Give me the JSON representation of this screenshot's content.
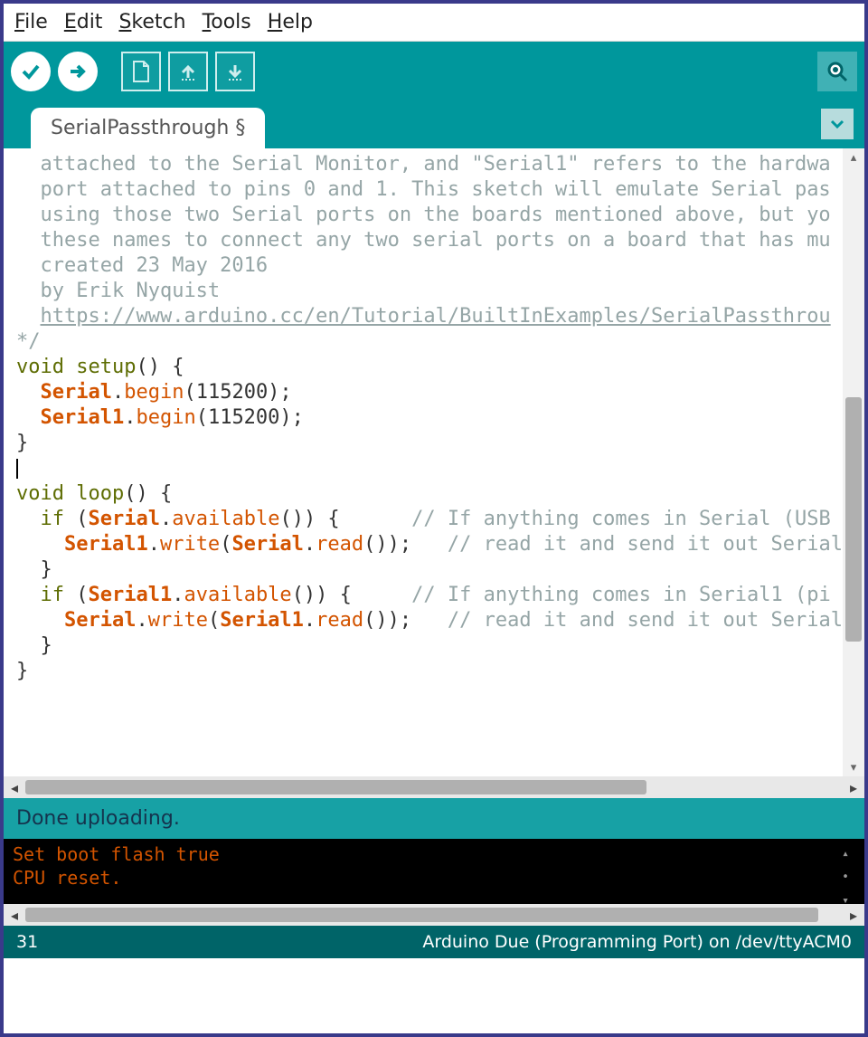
{
  "menu": {
    "file": "File",
    "edit": "Edit",
    "sketch": "Sketch",
    "tools": "Tools",
    "help": "Help"
  },
  "toolbar_icons": {
    "verify": "check-icon",
    "upload": "arrow-right-icon",
    "new": "file-icon",
    "open": "arrow-up-icon",
    "save": "arrow-down-icon",
    "serial_monitor": "magnifier-icon"
  },
  "tab": {
    "name": "SerialPassthrough",
    "modified": "§"
  },
  "code_lines": [
    {
      "indent": "  ",
      "spans": [
        [
          "c-comment",
          "attached to the Serial Monitor, and \"Serial1\" refers to the hardwa"
        ]
      ]
    },
    {
      "indent": "  ",
      "spans": [
        [
          "c-comment",
          "port attached to pins 0 and 1. This sketch will emulate Serial pas"
        ]
      ]
    },
    {
      "indent": "  ",
      "spans": [
        [
          "c-comment",
          "using those two Serial ports on the boards mentioned above, but yo"
        ]
      ]
    },
    {
      "indent": "  ",
      "spans": [
        [
          "c-comment",
          "these names to connect any two serial ports on a board that has mu"
        ]
      ]
    },
    {
      "indent": "",
      "spans": [
        [
          "c-comment",
          ""
        ]
      ]
    },
    {
      "indent": "  ",
      "spans": [
        [
          "c-comment",
          "created 23 May 2016"
        ]
      ]
    },
    {
      "indent": "  ",
      "spans": [
        [
          "c-comment",
          "by Erik Nyquist"
        ]
      ]
    },
    {
      "indent": "",
      "spans": [
        [
          "c-comment",
          ""
        ]
      ]
    },
    {
      "indent": "  ",
      "spans": [
        [
          "c-link",
          "https://www.arduino.cc/en/Tutorial/BuiltInExamples/SerialPassthrou"
        ]
      ]
    },
    {
      "indent": "",
      "spans": [
        [
          "c-comment",
          "*/"
        ]
      ]
    },
    {
      "indent": "",
      "spans": [
        [
          "",
          ""
        ]
      ]
    },
    {
      "indent": "",
      "spans": [
        [
          "c-kw",
          "void"
        ],
        [
          "",
          " "
        ],
        [
          "c-kw",
          "setup"
        ],
        [
          "c-struct",
          "() {"
        ]
      ]
    },
    {
      "indent": "  ",
      "spans": [
        [
          "c-class",
          "Serial"
        ],
        [
          "c-struct",
          "."
        ],
        [
          "c-method",
          "begin"
        ],
        [
          "c-struct",
          "(115200);"
        ]
      ]
    },
    {
      "indent": "  ",
      "spans": [
        [
          "c-class",
          "Serial1"
        ],
        [
          "c-struct",
          "."
        ],
        [
          "c-method",
          "begin"
        ],
        [
          "c-struct",
          "(115200);"
        ]
      ]
    },
    {
      "indent": "",
      "spans": [
        [
          "c-struct",
          "}"
        ]
      ]
    },
    {
      "indent": "",
      "spans": [
        [
          "cursor",
          ""
        ]
      ]
    },
    {
      "indent": "",
      "spans": [
        [
          "c-kw",
          "void"
        ],
        [
          "",
          " "
        ],
        [
          "c-kw",
          "loop"
        ],
        [
          "c-struct",
          "() {"
        ]
      ]
    },
    {
      "indent": "  ",
      "spans": [
        [
          "c-kw",
          "if"
        ],
        [
          "c-struct",
          " ("
        ],
        [
          "c-class",
          "Serial"
        ],
        [
          "c-struct",
          "."
        ],
        [
          "c-method",
          "available"
        ],
        [
          "c-struct",
          "()) {      "
        ],
        [
          "c-comment",
          "// If anything comes in Serial (USB"
        ]
      ]
    },
    {
      "indent": "    ",
      "spans": [
        [
          "c-class",
          "Serial1"
        ],
        [
          "c-struct",
          "."
        ],
        [
          "c-method",
          "write"
        ],
        [
          "c-struct",
          "("
        ],
        [
          "c-class",
          "Serial"
        ],
        [
          "c-struct",
          "."
        ],
        [
          "c-method",
          "read"
        ],
        [
          "c-struct",
          "());   "
        ],
        [
          "c-comment",
          "// read it and send it out Serial"
        ]
      ]
    },
    {
      "indent": "  ",
      "spans": [
        [
          "c-struct",
          "}"
        ]
      ]
    },
    {
      "indent": "",
      "spans": [
        [
          "",
          ""
        ]
      ]
    },
    {
      "indent": "  ",
      "spans": [
        [
          "c-kw",
          "if"
        ],
        [
          "c-struct",
          " ("
        ],
        [
          "c-class",
          "Serial1"
        ],
        [
          "c-struct",
          "."
        ],
        [
          "c-method",
          "available"
        ],
        [
          "c-struct",
          "()) {     "
        ],
        [
          "c-comment",
          "// If anything comes in Serial1 (pi"
        ]
      ]
    },
    {
      "indent": "    ",
      "spans": [
        [
          "c-class",
          "Serial"
        ],
        [
          "c-struct",
          "."
        ],
        [
          "c-method",
          "write"
        ],
        [
          "c-struct",
          "("
        ],
        [
          "c-class",
          "Serial1"
        ],
        [
          "c-struct",
          "."
        ],
        [
          "c-method",
          "read"
        ],
        [
          "c-struct",
          "());   "
        ],
        [
          "c-comment",
          "// read it and send it out Serial"
        ]
      ]
    },
    {
      "indent": "  ",
      "spans": [
        [
          "c-struct",
          "}"
        ]
      ]
    },
    {
      "indent": "",
      "spans": [
        [
          "c-struct",
          "}"
        ]
      ]
    }
  ],
  "status_message": "Done uploading.",
  "console_lines": [
    "Set boot flash true",
    "CPU reset."
  ],
  "footer": {
    "line_number": "31",
    "board_port": "Arduino Due (Programming Port) on /dev/ttyACM0"
  }
}
